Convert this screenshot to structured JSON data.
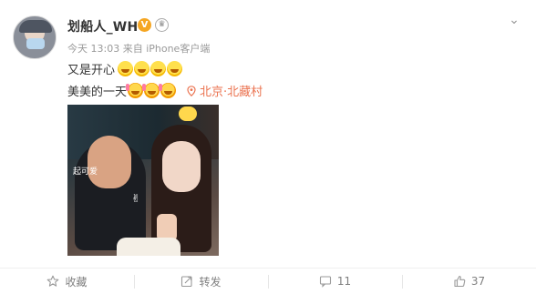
{
  "post": {
    "username": "划船人_WH",
    "verified_badge": "V",
    "member_badge": "♛",
    "meta": "今天 13:03 来自 iPhone客户端",
    "text_line1": "又是开心",
    "text_line2": "美美的一天",
    "location": "北京·北藏村"
  },
  "photo": {
    "doodle_1": "起可爱",
    "doodle_2": "✌"
  },
  "actions": {
    "favorite_label": "收藏",
    "repost_label": "转发",
    "comment_count": "11",
    "like_count": "37"
  },
  "colors": {
    "link_orange": "#eb7350",
    "muted_gray": "#999999",
    "badge_gold": "#f5a623"
  }
}
